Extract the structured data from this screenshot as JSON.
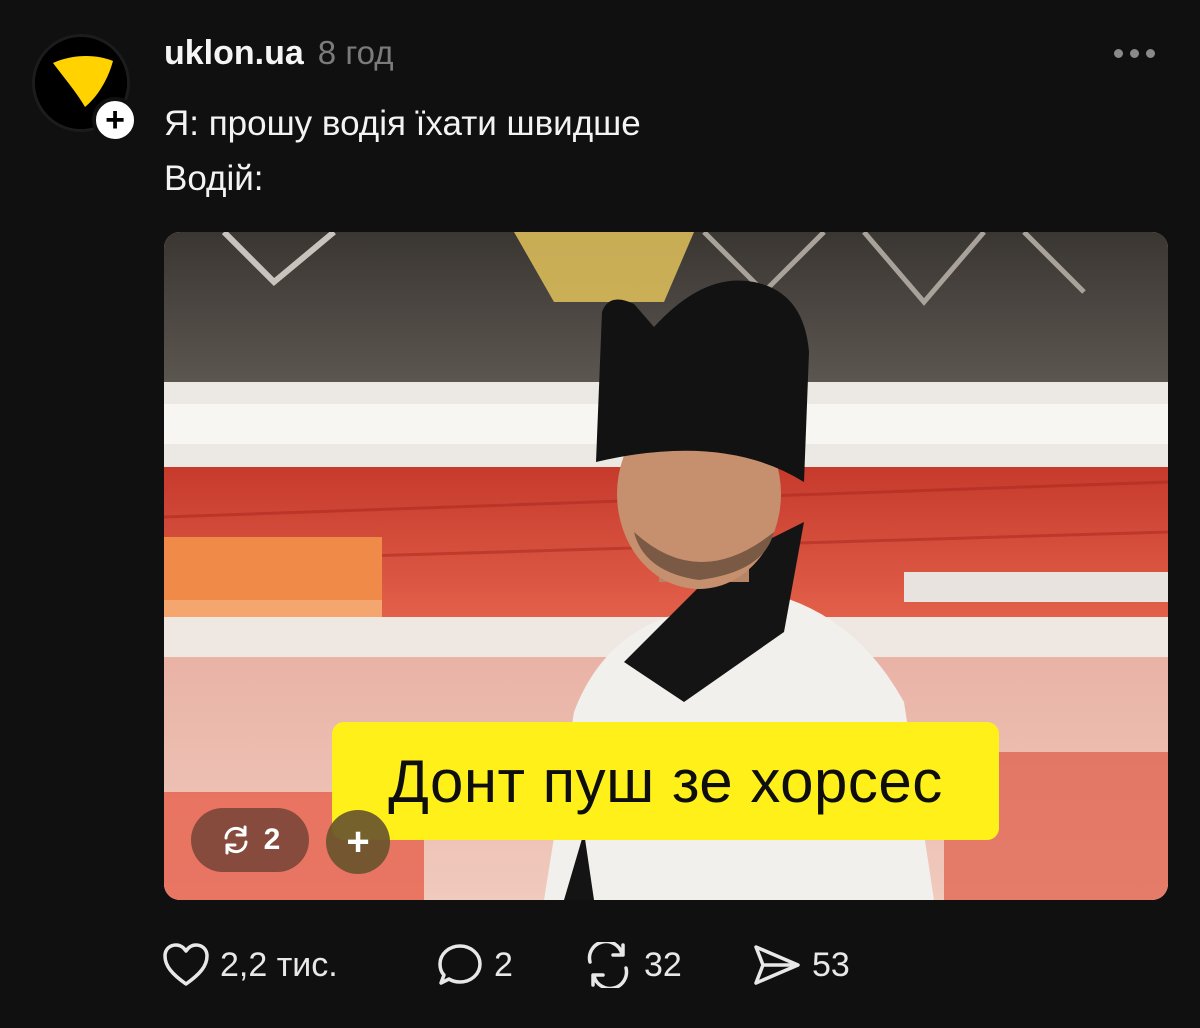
{
  "post": {
    "username": "uklon.ua",
    "time_ago": "8 год",
    "caption_lines": [
      "Я: прошу водія їхати швидше",
      "Водій:"
    ],
    "follow_symbol": "+",
    "more_icon": "more-horizontal-icon"
  },
  "media": {
    "banner_text": "Донт пуш зе хорсес",
    "banner_color": "#fff01a",
    "repost_count": "2",
    "add_symbol": "+"
  },
  "actions": {
    "likes": "2,2 тис.",
    "replies": "2",
    "reposts": "32",
    "shares": "53"
  },
  "colors": {
    "background": "#101010",
    "brand_yellow": "#ffd200",
    "muted_text": "#7b7b7b"
  }
}
